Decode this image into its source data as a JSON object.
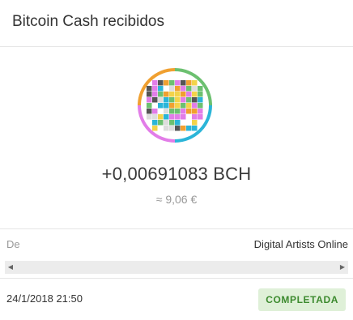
{
  "header": {
    "title": "Bitcoin Cash recibidos"
  },
  "transaction": {
    "amount": "+0,00691083 BCH",
    "fiat": "≈ 9,06 €",
    "from_label": "De",
    "from_value": "Digital Artists Online",
    "date": "24/1/2018 21:50",
    "status": "COMPLETADA"
  },
  "icons": {
    "avatar": "identicon-avatar",
    "scroll_left": "scroll-left-arrow-icon",
    "scroll_right": "scroll-right-arrow-icon"
  },
  "colors": {
    "ring_orange": "#f0a030",
    "ring_green": "#6cc070",
    "ring_blue": "#2bb5d8",
    "ring_pink": "#e27de8",
    "status_bg": "#dff0d8",
    "status_text": "#3c8a2e"
  }
}
